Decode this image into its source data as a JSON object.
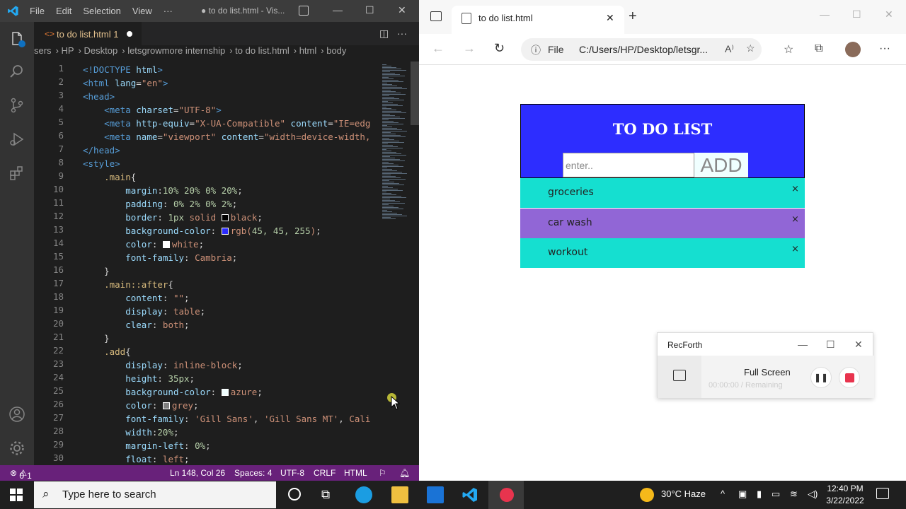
{
  "vscode": {
    "menu": [
      "File",
      "Edit",
      "Selection",
      "View",
      "···"
    ],
    "window_title": "● to do list.html - Vis...",
    "tab": {
      "label": "to do list.html",
      "problems": "1"
    },
    "breadcrumb": [
      "sers",
      "HP",
      "Desktop",
      "letsgrowmore internship",
      "to do list.html",
      "html",
      "body"
    ],
    "lines": [
      "1",
      "2",
      "3",
      "4",
      "5",
      "6",
      "7",
      "8",
      "9",
      "10",
      "11",
      "12",
      "13",
      "14",
      "15",
      "16",
      "17",
      "18",
      "19",
      "20",
      "21",
      "22",
      "23",
      "24",
      "25",
      "26",
      "27",
      "28",
      "29",
      "30"
    ],
    "status": {
      "errors": "0",
      "warnings": "1",
      "position": "Ln 148, Col 26",
      "spaces": "Spaces: 4",
      "encoding": "UTF-8",
      "eol": "CRLF",
      "language": "HTML"
    },
    "colors": {
      "accent": "#68217a",
      "swatch_black": "#000000",
      "swatch_blue": "#2d2dff",
      "swatch_white": "#ffffff",
      "swatch_azure": "#f0ffff",
      "swatch_grey": "#808080"
    }
  },
  "browser": {
    "tab_title": "to do list.html",
    "url_scheme": "File",
    "url": "C:/Users/HP/Desktop/letsgr...",
    "page": {
      "heading": "TO DO LIST",
      "input_placeholder": "enter..",
      "add_label": "ADD",
      "items": [
        {
          "label": "groceries",
          "color": "#15dfd0"
        },
        {
          "label": "car wash",
          "color": "#9166d6"
        },
        {
          "label": "workout",
          "color": "#15dfd0"
        }
      ],
      "close": "×"
    }
  },
  "recforth": {
    "title": "RecForth",
    "mode": "Full Screen",
    "timer": "00:00:00",
    "remaining": "/ Remaining"
  },
  "taskbar": {
    "search_placeholder": "Type here to search",
    "weather": "30°C  Haze",
    "time": "12:40 PM",
    "date": "3/22/2022"
  }
}
